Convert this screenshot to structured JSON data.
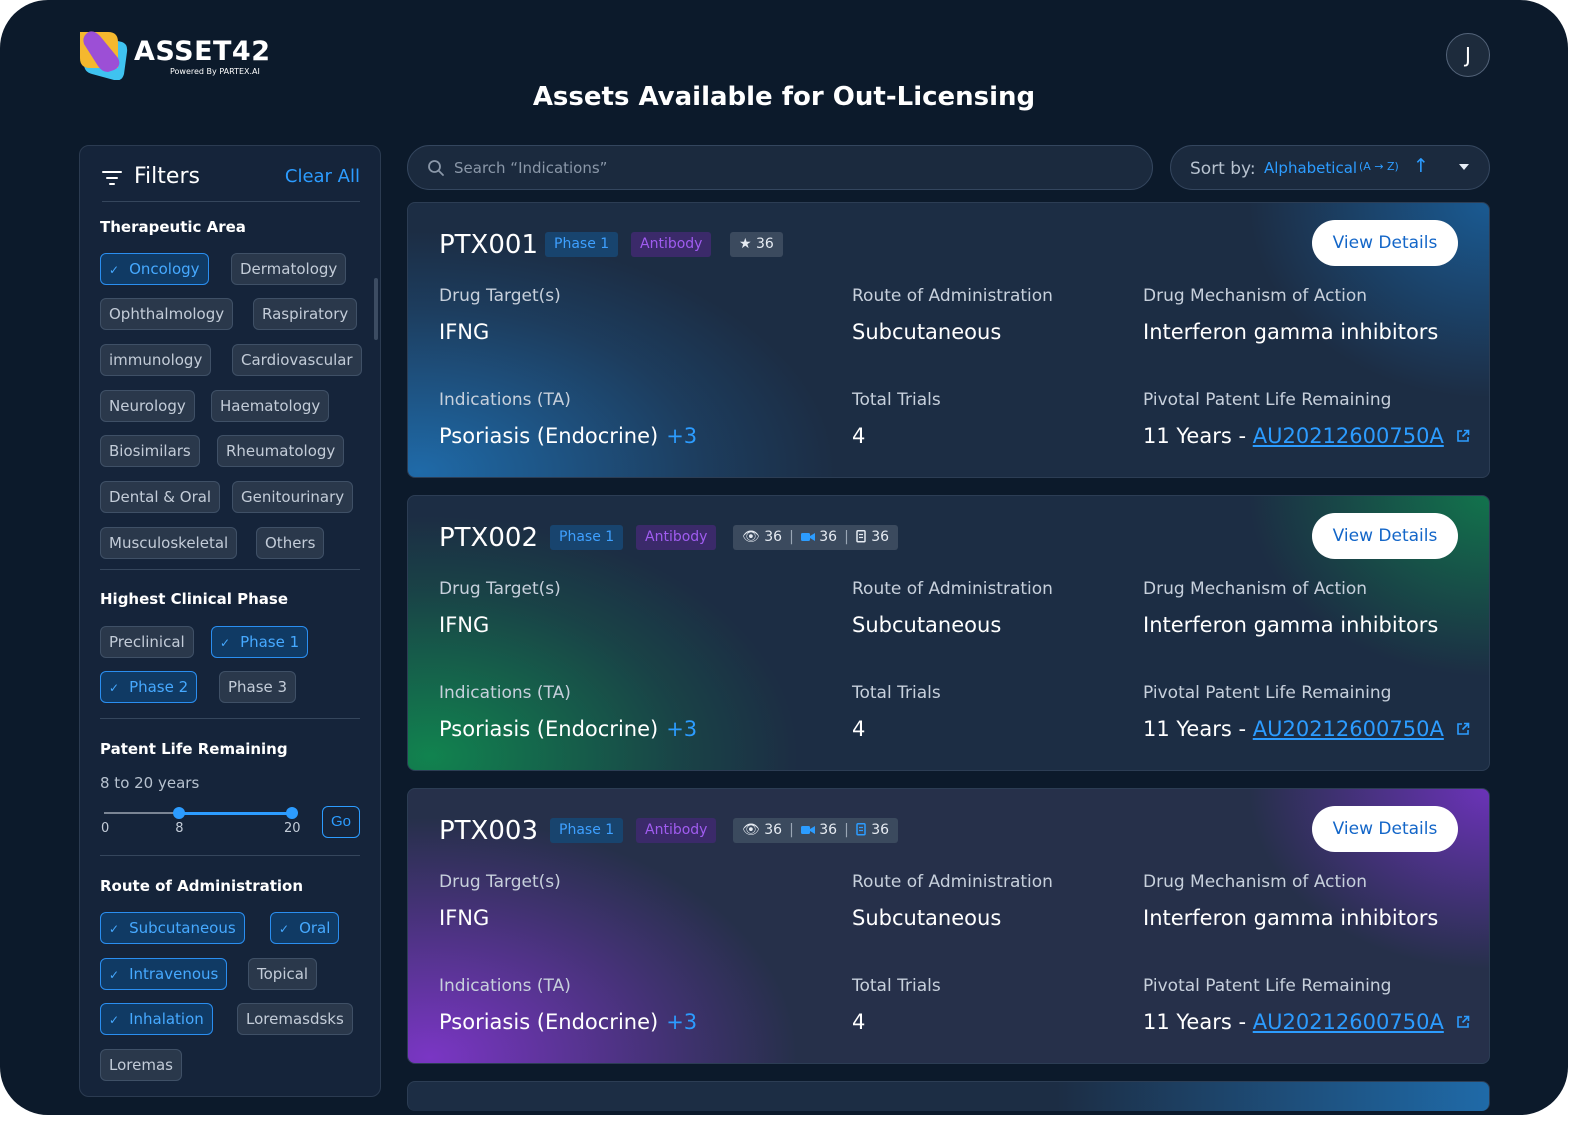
{
  "app": {
    "brand": "ASSET42",
    "brand_sub": "Powered By PARTEX.AI",
    "avatar_initial": "J",
    "page_title": "Assets Available for Out-Licensing"
  },
  "filters": {
    "title": "Filters",
    "clear_all": "Clear All",
    "therapeutic_area": {
      "title": "Therapeutic Area",
      "options": [
        {
          "label": "Oncology",
          "selected": true
        },
        {
          "label": "Dermatology",
          "selected": false
        },
        {
          "label": "Ophthalmology",
          "selected": false
        },
        {
          "label": "Raspiratory",
          "selected": false
        },
        {
          "label": "immunology",
          "selected": false
        },
        {
          "label": "Cardiovascular",
          "selected": false
        },
        {
          "label": "Neurology",
          "selected": false
        },
        {
          "label": "Haematology",
          "selected": false
        },
        {
          "label": "Biosimilars",
          "selected": false
        },
        {
          "label": "Rheumatology",
          "selected": false
        },
        {
          "label": "Dental & Oral",
          "selected": false
        },
        {
          "label": "Genitourinary",
          "selected": false
        },
        {
          "label": "Musculoskeletal",
          "selected": false
        },
        {
          "label": "Others",
          "selected": false
        }
      ]
    },
    "clinical_phase": {
      "title": "Highest Clinical Phase",
      "options": [
        {
          "label": "Preclinical",
          "selected": false
        },
        {
          "label": "Phase 1",
          "selected": true
        },
        {
          "label": "Phase 2",
          "selected": true
        },
        {
          "label": "Phase 3",
          "selected": false
        }
      ]
    },
    "patent_life": {
      "title": "Patent Life Remaining",
      "range_text": "8 to 20 years",
      "min": "0",
      "low": "8",
      "high": "20",
      "go_label": "Go"
    },
    "route": {
      "title": "Route of Administration",
      "options": [
        {
          "label": "Subcutaneous",
          "selected": true
        },
        {
          "label": "Oral",
          "selected": true
        },
        {
          "label": "Intravenous",
          "selected": true
        },
        {
          "label": "Topical",
          "selected": false
        },
        {
          "label": "Inhalation",
          "selected": true
        },
        {
          "label": "Loremasdsks",
          "selected": false
        },
        {
          "label": "Loremas",
          "selected": false
        }
      ]
    }
  },
  "search": {
    "placeholder": "Search “Indications”",
    "value": ""
  },
  "sort": {
    "label": "Sort by:",
    "value": "Alphabetical",
    "order": "(A → Z)"
  },
  "labels": {
    "drug_target": "Drug Target(s)",
    "route": "Route of Administration",
    "moa": "Drug Mechanism of Action",
    "indications": "Indications (TA)",
    "total_trials": "Total Trials",
    "patent": "Pivotal Patent Life Remaining",
    "view_details": "View Details"
  },
  "cards": [
    {
      "id": "PTX001",
      "theme": "blue",
      "phase": "Phase 1",
      "type": "Antibody",
      "star_count": "36",
      "drug_target": "IFNG",
      "route": "Subcutaneous",
      "moa": "Interferon gamma inhibitors",
      "indication": "Psoriasis (Endocrine)",
      "more": "+3",
      "total_trials": "4",
      "patent_years": "11 Years - ",
      "patent_id": "AU20212600750A"
    },
    {
      "id": "PTX002",
      "theme": "green",
      "phase": "Phase 1",
      "type": "Antibody",
      "stats": [
        "36",
        "36",
        "36"
      ],
      "drug_target": "IFNG",
      "route": "Subcutaneous",
      "moa": "Interferon gamma inhibitors",
      "indication": "Psoriasis (Endocrine)",
      "more": "+3",
      "total_trials": "4",
      "patent_years": "11 Years - ",
      "patent_id": "AU20212600750A"
    },
    {
      "id": "PTX003",
      "theme": "purple",
      "phase": "Phase 1",
      "type": "Antibody",
      "stats": [
        "36",
        "36",
        "36"
      ],
      "drug_target": "IFNG",
      "route": "Subcutaneous",
      "moa": "Interferon gamma inhibitors",
      "indication": "Psoriasis (Endocrine)",
      "more": "+3",
      "total_trials": "4",
      "patent_years": "11 Years - ",
      "patent_id": "AU20212600750A"
    }
  ],
  "colors": {
    "background": "#0c1a2b",
    "accent": "#2c9cff",
    "phase_badge": "#18446e",
    "type_badge": "#3b2a6a"
  }
}
